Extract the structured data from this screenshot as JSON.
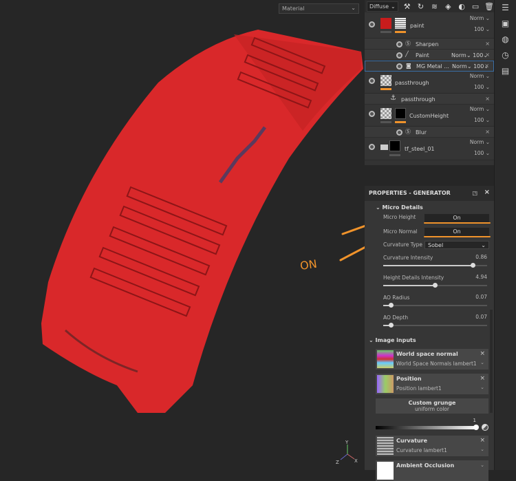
{
  "viewport": {
    "material_select": "Material",
    "annotation": "ON",
    "accent": "#f0932b"
  },
  "toolbar": {
    "channel": "Diffuse"
  },
  "layers": [
    {
      "name": "paint",
      "blend": "Norm",
      "opacity": "100",
      "subs": [
        {
          "name": "Sharpen",
          "icon": "filter-icon"
        },
        {
          "name": "Paint",
          "icon": "brush-icon",
          "blend": "Norm",
          "opacity": "100"
        },
        {
          "name": "MG Metal ...",
          "icon": "generator-icon",
          "blend": "Norm",
          "opacity": "100"
        }
      ]
    },
    {
      "name": "passthrough",
      "blend": "Norm",
      "opacity": "100",
      "subs": [
        {
          "name": "passthrough",
          "icon": "anchor-icon"
        }
      ]
    },
    {
      "name": "CustomHeight",
      "blend": "Norm",
      "opacity": "100",
      "subs": [
        {
          "name": "Blur",
          "icon": "filter-icon"
        }
      ]
    },
    {
      "name": "tf_steel_01",
      "blend": "Norm",
      "opacity": "100"
    }
  ],
  "properties": {
    "title": "PROPERTIES - GENERATOR",
    "micro_details": "Micro Details",
    "micro_height": {
      "label": "Micro Height",
      "value": "On"
    },
    "micro_normal": {
      "label": "Micro Normal",
      "value": "On"
    },
    "curvature_type": {
      "label": "Curvature Type",
      "value": "Sobel"
    },
    "sliders": [
      {
        "label": "Curvature Intensity",
        "value": "0.86",
        "fraction": 0.86
      },
      {
        "label": "Height Details Intensity",
        "value": "4.94",
        "fraction": 0.494
      },
      {
        "label": "AO Radius",
        "value": "0.07",
        "fraction": 0.07
      },
      {
        "label": "AO Depth",
        "value": "0.07",
        "fraction": 0.07
      }
    ],
    "image_inputs": "Image inputs",
    "inputs": [
      {
        "title": "World space normal",
        "source": "World Space Normals lambert1"
      },
      {
        "title": "Position",
        "source": "Position lambert1"
      }
    ],
    "custom_grunge": {
      "title": "Custom grunge",
      "value": "uniform color",
      "level": "1"
    },
    "curvature": {
      "title": "Curvature",
      "source": "Curvature lambert1"
    },
    "ambient_occlusion": {
      "title": "Ambient Occlusion"
    }
  }
}
